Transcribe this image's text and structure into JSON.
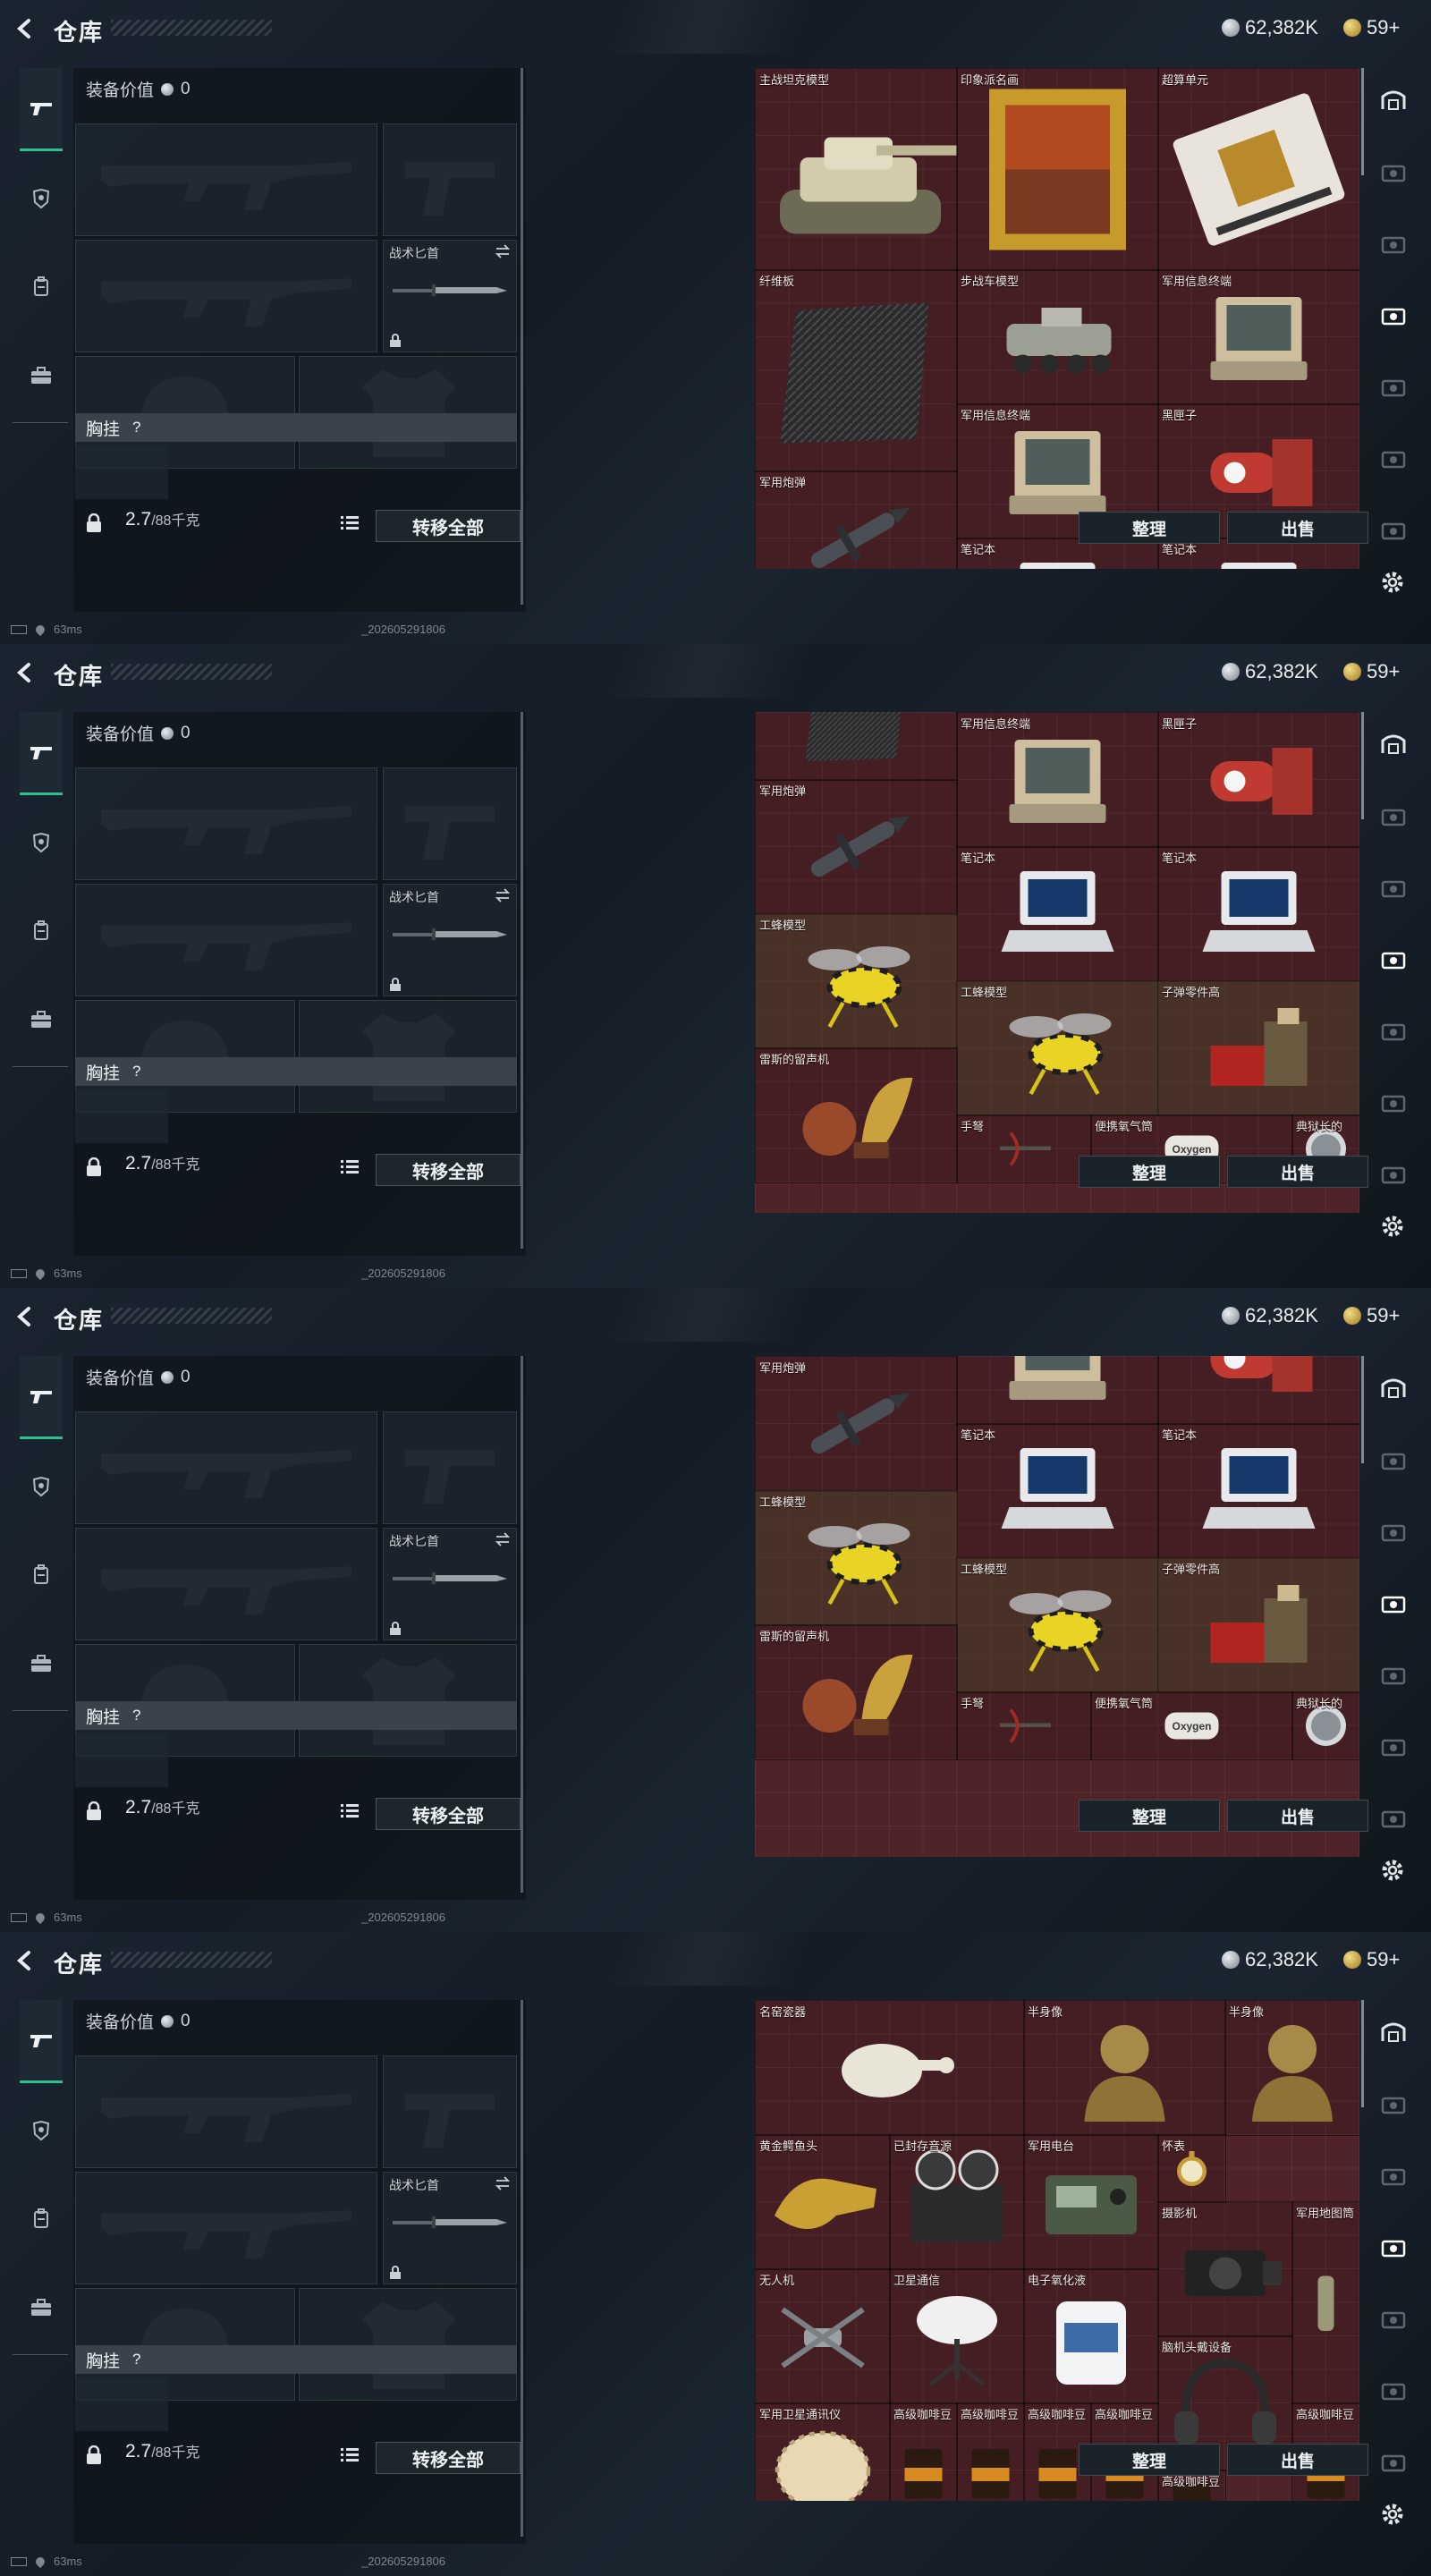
{
  "colors": {
    "accent_green": "#27c28a",
    "stash_bg": "#4f2328",
    "panel_bg": "#0c1116"
  },
  "header": {
    "title": "仓库",
    "silver_amount": "62,382K",
    "gold_amount": "59+"
  },
  "tabs": [
    {
      "name": "weapon-tab-icon"
    },
    {
      "name": "armor-tab-icon"
    },
    {
      "name": "backpack-tab-icon"
    },
    {
      "name": "case-tab-icon"
    }
  ],
  "equipment": {
    "value_label": "装备价值",
    "value_amount": "0",
    "melee_label": "战术匕首",
    "chest_label": "胸挂",
    "chest_hint": "?",
    "weight_current": "2.7",
    "weight_max": "/88千克",
    "transfer_all": "转移全部"
  },
  "stash": {
    "sort_label": "整理",
    "sell_label": "出售"
  },
  "status": {
    "ping": "63ms",
    "build": "_202605291806"
  },
  "screens": [
    {
      "items": [
        {
          "label": "主战坦克模型",
          "art": "tank",
          "x": 0,
          "y": 0,
          "w": 3,
          "h": 3
        },
        {
          "label": "印象派名画",
          "art": "painting",
          "x": 3,
          "y": 0,
          "w": 3,
          "h": 3
        },
        {
          "label": "超算单元",
          "art": "board",
          "x": 6,
          "y": 0,
          "w": 3,
          "h": 3
        },
        {
          "label": "纤维板",
          "art": "carbon",
          "x": 0,
          "y": 3,
          "w": 3,
          "h": 3
        },
        {
          "label": "步战车模型",
          "art": "ifv",
          "x": 3,
          "y": 3,
          "w": 3,
          "h": 2
        },
        {
          "label": "军用信息终端",
          "art": "terminal",
          "x": 6,
          "y": 3,
          "w": 3,
          "h": 2
        },
        {
          "label": "军用信息终端",
          "art": "terminal",
          "x": 3,
          "y": 5,
          "w": 3,
          "h": 2
        },
        {
          "label": "黑匣子",
          "art": "blackbox",
          "x": 6,
          "y": 5,
          "w": 3,
          "h": 2
        },
        {
          "label": "军用炮弹",
          "art": "shell",
          "x": 0,
          "y": 6,
          "w": 3,
          "h": 2
        },
        {
          "label": "笔记本",
          "art": "laptop",
          "x": 3,
          "y": 7,
          "w": 3,
          "h": 2
        },
        {
          "label": "笔记本",
          "art": "laptop",
          "x": 6,
          "y": 7,
          "w": 3,
          "h": 2
        }
      ]
    },
    {
      "items": [
        {
          "label": "",
          "art": "carbon",
          "x": 0,
          "y": -1,
          "w": 3,
          "h": 2
        },
        {
          "label": "军用信息终端",
          "art": "terminal",
          "x": 3,
          "y": 0,
          "w": 3,
          "h": 2
        },
        {
          "label": "黑匣子",
          "art": "blackbox",
          "x": 6,
          "y": 0,
          "w": 3,
          "h": 2
        },
        {
          "label": "军用炮弹",
          "art": "shell",
          "x": 0,
          "y": 1,
          "w": 3,
          "h": 2
        },
        {
          "label": "笔记本",
          "art": "laptop",
          "x": 3,
          "y": 2,
          "w": 3,
          "h": 2
        },
        {
          "label": "笔记本",
          "art": "laptop",
          "x": 6,
          "y": 2,
          "w": 3,
          "h": 2
        },
        {
          "label": "工蜂模型",
          "art": "wasp",
          "x": 0,
          "y": 3,
          "w": 3,
          "h": 2,
          "olive": true
        },
        {
          "label": "工蜂模型",
          "art": "wasp",
          "x": 3,
          "y": 4,
          "w": 3,
          "h": 2,
          "olive": true
        },
        {
          "label": "子弹零件高",
          "art": "parts",
          "x": 6,
          "y": 4,
          "w": 3,
          "h": 2,
          "olive": true
        },
        {
          "label": "雷斯的留声机",
          "art": "phonograph",
          "x": 0,
          "y": 5,
          "w": 3,
          "h": 2
        },
        {
          "label": "手弩",
          "art": "crossbow",
          "x": 3,
          "y": 6,
          "w": 2,
          "h": 1
        },
        {
          "label": "便携氧气筒",
          "art": "oxygen",
          "x": 5,
          "y": 6,
          "w": 3,
          "h": 1
        },
        {
          "label": "典狱长的",
          "art": "badge",
          "x": 8,
          "y": 6,
          "w": 1,
          "h": 1
        }
      ]
    },
    {
      "items": [
        {
          "label": "",
          "art": "terminal",
          "x": 3,
          "y": -1,
          "w": 3,
          "h": 2
        },
        {
          "label": "",
          "art": "blackbox",
          "x": 6,
          "y": -1,
          "w": 3,
          "h": 2
        },
        {
          "label": "军用炮弹",
          "art": "shell",
          "x": 0,
          "y": 0,
          "w": 3,
          "h": 2
        },
        {
          "label": "笔记本",
          "art": "laptop",
          "x": 3,
          "y": 1,
          "w": 3,
          "h": 2
        },
        {
          "label": "笔记本",
          "art": "laptop",
          "x": 6,
          "y": 1,
          "w": 3,
          "h": 2
        },
        {
          "label": "工蜂模型",
          "art": "wasp",
          "x": 0,
          "y": 2,
          "w": 3,
          "h": 2,
          "olive": true
        },
        {
          "label": "工蜂模型",
          "art": "wasp",
          "x": 3,
          "y": 3,
          "w": 3,
          "h": 2,
          "olive": true
        },
        {
          "label": "子弹零件高",
          "art": "parts",
          "x": 6,
          "y": 3,
          "w": 3,
          "h": 2,
          "olive": true
        },
        {
          "label": "雷斯的留声机",
          "art": "phonograph",
          "x": 0,
          "y": 4,
          "w": 3,
          "h": 2
        },
        {
          "label": "手弩",
          "art": "crossbow",
          "x": 3,
          "y": 5,
          "w": 2,
          "h": 1
        },
        {
          "label": "便携氧气筒",
          "art": "oxygen",
          "x": 5,
          "y": 5,
          "w": 3,
          "h": 1
        },
        {
          "label": "典狱长的",
          "art": "badge",
          "x": 8,
          "y": 5,
          "w": 1,
          "h": 1
        }
      ]
    },
    {
      "items": [
        {
          "label": "名窑瓷器",
          "art": "vase",
          "x": 0,
          "y": 0,
          "w": 4,
          "h": 2
        },
        {
          "label": "半身像",
          "art": "bust",
          "x": 4,
          "y": 0,
          "w": 3,
          "h": 2
        },
        {
          "label": "半身像",
          "art": "bust",
          "x": 7,
          "y": 0,
          "w": 2,
          "h": 2
        },
        {
          "label": "黄金鳄鱼头",
          "art": "croc",
          "x": 0,
          "y": 2,
          "w": 2,
          "h": 2
        },
        {
          "label": "已封存音源",
          "art": "recorder",
          "x": 2,
          "y": 2,
          "w": 2,
          "h": 2
        },
        {
          "label": "军用电台",
          "art": "radio",
          "x": 4,
          "y": 2,
          "w": 2,
          "h": 2
        },
        {
          "label": "怀表",
          "art": "watch",
          "x": 6,
          "y": 2,
          "w": 1,
          "h": 1
        },
        {
          "label": "摄影机",
          "art": "camera",
          "x": 6,
          "y": 3,
          "w": 2,
          "h": 2
        },
        {
          "label": "军用地图筒",
          "art": "tube",
          "x": 8,
          "y": 3,
          "w": 1,
          "h": 3
        },
        {
          "label": "无人机",
          "art": "drone",
          "x": 0,
          "y": 4,
          "w": 2,
          "h": 2
        },
        {
          "label": "卫星通信",
          "art": "dish",
          "x": 2,
          "y": 4,
          "w": 2,
          "h": 2
        },
        {
          "label": "电子氧化液",
          "art": "jug",
          "x": 4,
          "y": 4,
          "w": 2,
          "h": 2
        },
        {
          "label": "脑机头戴设备",
          "art": "headset",
          "x": 6,
          "y": 5,
          "w": 2,
          "h": 2
        },
        {
          "label": "军用卫星通讯仪",
          "art": "coral",
          "x": 0,
          "y": 6,
          "w": 2,
          "h": 2
        },
        {
          "label": "高级咖啡豆",
          "art": "coffee",
          "x": 2,
          "y": 6,
          "w": 1,
          "h": 2
        },
        {
          "label": "高级咖啡豆",
          "art": "coffee",
          "x": 3,
          "y": 6,
          "w": 1,
          "h": 2
        },
        {
          "label": "高级咖啡豆",
          "art": "coffee",
          "x": 4,
          "y": 6,
          "w": 1,
          "h": 2
        },
        {
          "label": "高级咖啡豆",
          "art": "coffee",
          "x": 5,
          "y": 6,
          "w": 1,
          "h": 2
        },
        {
          "label": "高级咖啡豆",
          "art": "coffee",
          "x": 8,
          "y": 6,
          "w": 1,
          "h": 2
        },
        {
          "label": "高级咖啡豆",
          "art": "coffee",
          "x": 6,
          "y": 7,
          "w": 1,
          "h": 1
        }
      ]
    }
  ]
}
